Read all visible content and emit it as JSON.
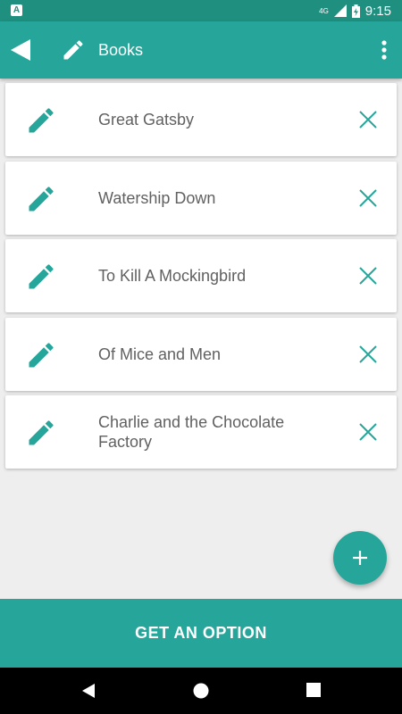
{
  "status_bar": {
    "network": "4G",
    "time": "9:15"
  },
  "app_bar": {
    "title": "Books"
  },
  "books": [
    {
      "title": "Great Gatsby"
    },
    {
      "title": "Watership Down"
    },
    {
      "title": "To Kill A Mockingbird"
    },
    {
      "title": "Of Mice and Men"
    },
    {
      "title": "Charlie and the Chocolate Factory"
    }
  ],
  "cta": {
    "label": "GET AN OPTION"
  },
  "colors": {
    "primary": "#26a69a",
    "primary_dark": "#1f8f80",
    "background": "#eeeeee",
    "text": "#616161"
  },
  "icons": {
    "back": "arrow-left-icon",
    "title": "pencil-icon",
    "overflow": "more-vert-icon",
    "edit": "pencil-icon",
    "delete": "close-icon",
    "add": "plus-icon"
  }
}
